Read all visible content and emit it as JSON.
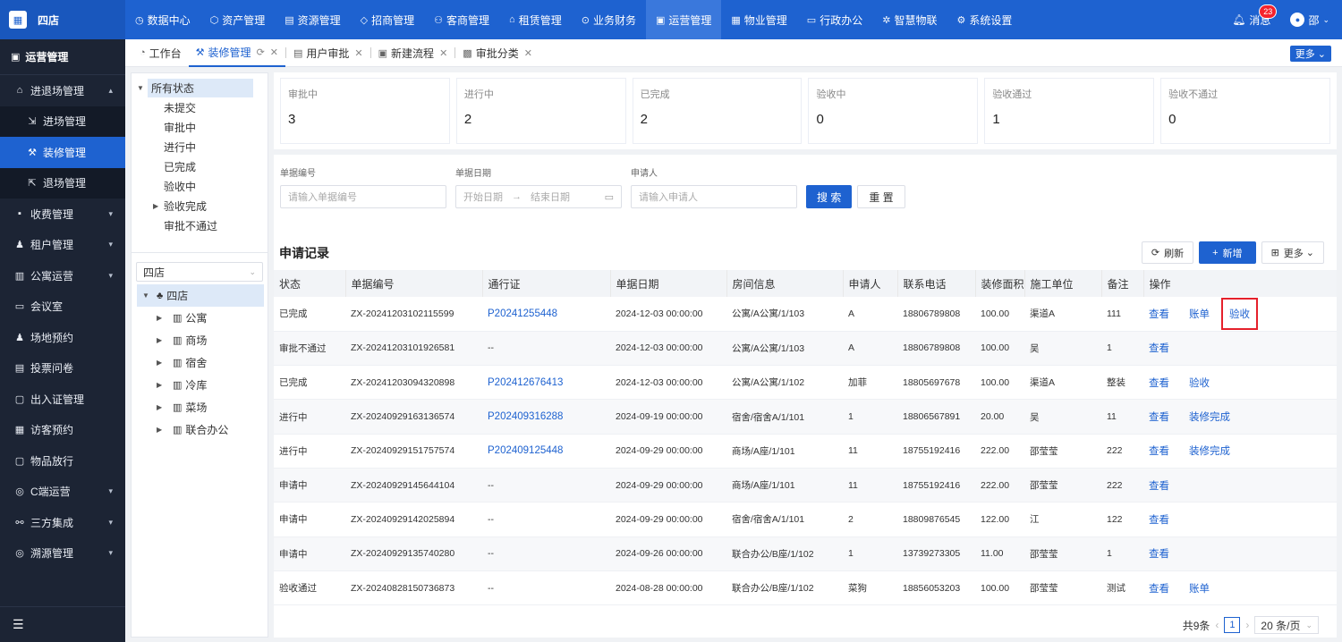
{
  "app": {
    "logo_text": "四店",
    "logo_icon": "building-icon"
  },
  "topnav": [
    {
      "label": "数据中心",
      "icon": "dashboard-icon"
    },
    {
      "label": "资产管理",
      "icon": "cube-icon"
    },
    {
      "label": "资源管理",
      "icon": "document-icon"
    },
    {
      "label": "招商管理",
      "icon": "tag-icon"
    },
    {
      "label": "客商管理",
      "icon": "users-icon"
    },
    {
      "label": "租赁管理",
      "icon": "house-icon"
    },
    {
      "label": "业务财务",
      "icon": "coin-icon"
    },
    {
      "label": "运营管理",
      "icon": "grid-icon",
      "active": true
    },
    {
      "label": "物业管理",
      "icon": "building-icon"
    },
    {
      "label": "行政办公",
      "icon": "monitor-icon"
    },
    {
      "label": "智慧物联",
      "icon": "iot-icon"
    },
    {
      "label": "系统设置",
      "icon": "gear-icon"
    }
  ],
  "topright": {
    "message_label": "消息",
    "message_count": "23",
    "user_name": "邵"
  },
  "sidebar": {
    "header": "运营管理",
    "items": [
      {
        "label": "进退场管理",
        "icon": "door-icon",
        "arrow": "▴"
      },
      {
        "label": "进场管理",
        "icon": "enter-icon",
        "sub": true
      },
      {
        "label": "装修管理",
        "icon": "paint-icon",
        "sub": true,
        "active": true
      },
      {
        "label": "退场管理",
        "icon": "exit-icon",
        "sub": true
      },
      {
        "label": "收费管理",
        "icon": "wallet-icon",
        "arrow": "▾"
      },
      {
        "label": "租户管理",
        "icon": "user-icon",
        "arrow": "▾"
      },
      {
        "label": "公寓运营",
        "icon": "apartment-icon",
        "arrow": "▾"
      },
      {
        "label": "会议室",
        "icon": "meeting-icon"
      },
      {
        "label": "场地预约",
        "icon": "venue-icon"
      },
      {
        "label": "投票问卷",
        "icon": "survey-icon"
      },
      {
        "label": "出入证管理",
        "icon": "pass-icon"
      },
      {
        "label": "访客预约",
        "icon": "visitor-icon"
      },
      {
        "label": "物品放行",
        "icon": "package-icon"
      },
      {
        "label": "C端运营",
        "icon": "c-icon",
        "arrow": "▾"
      },
      {
        "label": "三方集成",
        "icon": "link-icon",
        "arrow": "▾"
      },
      {
        "label": "溯源管理",
        "icon": "trace-icon",
        "arrow": "▾"
      }
    ],
    "footer_icon": "menu-icon"
  },
  "tabs": [
    {
      "label": "工作台",
      "icon": "home-icon"
    },
    {
      "label": "装修管理",
      "icon": "paint-icon",
      "active": true
    },
    {
      "label": "用户审批",
      "icon": "doc-icon"
    },
    {
      "label": "新建流程",
      "icon": "flow-icon"
    },
    {
      "label": "审批分类",
      "icon": "category-icon"
    }
  ],
  "tabs_more": "更多 ⌄",
  "status_tree": {
    "root": "所有状态",
    "children": [
      "未提交",
      "审批中",
      "进行中",
      "已完成",
      "验收中",
      "验收完成",
      "审批不通过"
    ]
  },
  "store_select": "四店",
  "org_tree": {
    "root": "四店",
    "children": [
      "公寓",
      "商场",
      "宿舍",
      "冷库",
      "菜场",
      "联合办公"
    ]
  },
  "stats": [
    {
      "label": "审批中",
      "value": "3"
    },
    {
      "label": "进行中",
      "value": "2"
    },
    {
      "label": "已完成",
      "value": "2"
    },
    {
      "label": "验收中",
      "value": "0"
    },
    {
      "label": "验收通过",
      "value": "1"
    },
    {
      "label": "验收不通过",
      "value": "0"
    }
  ],
  "search": {
    "doc_no_label": "单据编号",
    "doc_no_placeholder": "请输入单据编号",
    "date_label": "单据日期",
    "date_start": "开始日期",
    "date_arrow": "→",
    "date_end": "结束日期",
    "applicant_label": "申请人",
    "applicant_placeholder": "请输入申请人",
    "search_btn": "搜 索",
    "reset_btn": "重 置"
  },
  "records": {
    "title": "申请记录",
    "refresh": "刷新",
    "add": "新增",
    "more": "更多",
    "columns": [
      "状态",
      "单据编号",
      "通行证",
      "单据日期",
      "房间信息",
      "申请人",
      "联系电话",
      "装修面积",
      "施工单位",
      "备注",
      "操作"
    ],
    "rows": [
      {
        "status": "已完成",
        "no": "ZX-20241203102115599",
        "pass": "P20241255448",
        "date": "2024-12-03 00:00:00",
        "room": "公寓/A公寓/1/103",
        "applicant": "A",
        "phone": "18806789808",
        "area": "100.00",
        "builder": "渠道A",
        "remark": "111",
        "ops": [
          "查看",
          "账单",
          "验收"
        ]
      },
      {
        "status": "审批不通过",
        "no": "ZX-20241203101926581",
        "pass": "--",
        "date": "2024-12-03 00:00:00",
        "room": "公寓/A公寓/1/103",
        "applicant": "A",
        "phone": "18806789808",
        "area": "100.00",
        "builder": "吴",
        "remark": "1",
        "ops": [
          "查看"
        ]
      },
      {
        "status": "已完成",
        "no": "ZX-20241203094320898",
        "pass": "P202412676413",
        "date": "2024-12-03 00:00:00",
        "room": "公寓/A公寓/1/102",
        "applicant": "加菲",
        "phone": "18805697678",
        "area": "100.00",
        "builder": "渠道A",
        "remark": "整装",
        "ops": [
          "查看",
          "验收"
        ]
      },
      {
        "status": "进行中",
        "no": "ZX-20240929163136574",
        "pass": "P202409316288",
        "date": "2024-09-19 00:00:00",
        "room": "宿舍/宿舍A/1/101",
        "applicant": "1",
        "phone": "18806567891",
        "area": "20.00",
        "builder": "吴",
        "remark": "11",
        "ops": [
          "查看",
          "装修完成"
        ]
      },
      {
        "status": "进行中",
        "no": "ZX-20240929151757574",
        "pass": "P202409125448",
        "date": "2024-09-29 00:00:00",
        "room": "商场/A座/1/101",
        "applicant": "11",
        "phone": "18755192416",
        "area": "222.00",
        "builder": "邵莹莹",
        "remark": "222",
        "ops": [
          "查看",
          "装修完成"
        ]
      },
      {
        "status": "申请中",
        "no": "ZX-20240929145644104",
        "pass": "--",
        "date": "2024-09-29 00:00:00",
        "room": "商场/A座/1/101",
        "applicant": "11",
        "phone": "18755192416",
        "area": "222.00",
        "builder": "邵莹莹",
        "remark": "222",
        "ops": [
          "查看"
        ]
      },
      {
        "status": "申请中",
        "no": "ZX-20240929142025894",
        "pass": "--",
        "date": "2024-09-29 00:00:00",
        "room": "宿舍/宿舍A/1/101",
        "applicant": "2",
        "phone": "18809876545",
        "area": "122.00",
        "builder": "江",
        "remark": "122",
        "ops": [
          "查看"
        ]
      },
      {
        "status": "申请中",
        "no": "ZX-20240929135740280",
        "pass": "--",
        "date": "2024-09-26 00:00:00",
        "room": "联合办公/B座/1/102",
        "applicant": "1",
        "phone": "13739273305",
        "area": "11.00",
        "builder": "邵莹莹",
        "remark": "1",
        "ops": [
          "查看"
        ]
      },
      {
        "status": "验收通过",
        "no": "ZX-20240828150736873",
        "pass": "--",
        "date": "2024-08-28 00:00:00",
        "room": "联合办公/B座/1/102",
        "applicant": "菜狗",
        "phone": "18856053203",
        "area": "100.00",
        "builder": "邵莹莹",
        "remark": "测试",
        "ops": [
          "查看",
          "账单"
        ]
      }
    ]
  },
  "pager": {
    "total": "共9条",
    "page": "1",
    "size": "20 条/页"
  },
  "colors": {
    "primary": "#1e62d0",
    "sidebar_bg": "#1c2434",
    "highlight_box": "#e5202b"
  }
}
